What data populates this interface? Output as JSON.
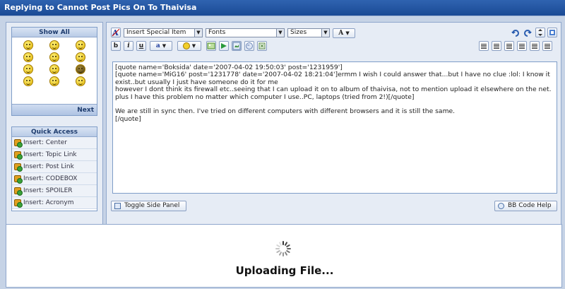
{
  "window": {
    "title": "Replying to Cannot Post Pics On To Thaivisa"
  },
  "emoticons": {
    "header": "Show All",
    "next_label": "Next",
    "icons": [
      "smile-icon",
      "angry-icon",
      "laugh-icon",
      "wink-icon",
      "huh-icon",
      "cool-icon",
      "sad-icon",
      "mad-icon",
      "ninja-icon",
      "blush-icon",
      "biggrin-icon",
      "happy-icon"
    ]
  },
  "quick_access": {
    "header": "Quick Access",
    "items": [
      "Insert: Center",
      "Insert: Topic Link",
      "Insert: Post Link",
      "Insert: CODEBOX",
      "Insert: SPOILER",
      "Insert: Acronym"
    ]
  },
  "toolbar": {
    "special_item": "Insert Special Item",
    "fonts": "Fonts",
    "sizes": "Sizes",
    "color_label": "A",
    "bold": "b",
    "italic": "i",
    "underline": "u",
    "font_color": "a"
  },
  "editor": {
    "content": "[quote name='Boksida' date='2007-04-02 19:50:03' post='1231959']\n[quote name='MiG16' post='1231778' date='2007-04-02 18:21:04']ermm I wish I could answer that...but I have no clue :lol: I know it exist..but usually I just have someone do it for me\nhowever I dont think its firewall etc..seeing that I can upload it on to album of thaivisa, not to mention upload it elsewhere on the net.\nplus I have this problem no matter which computer I use..PC, laptops (tried from 2!)[/quote]\n\nWe are still in sync then. I've tried on different computers with different browsers and it is still the same.\n[/quote]",
    "toggle_label": "Toggle Side Panel",
    "help_label": "BB Code Help"
  },
  "upload": {
    "status": "Uploading File..."
  }
}
